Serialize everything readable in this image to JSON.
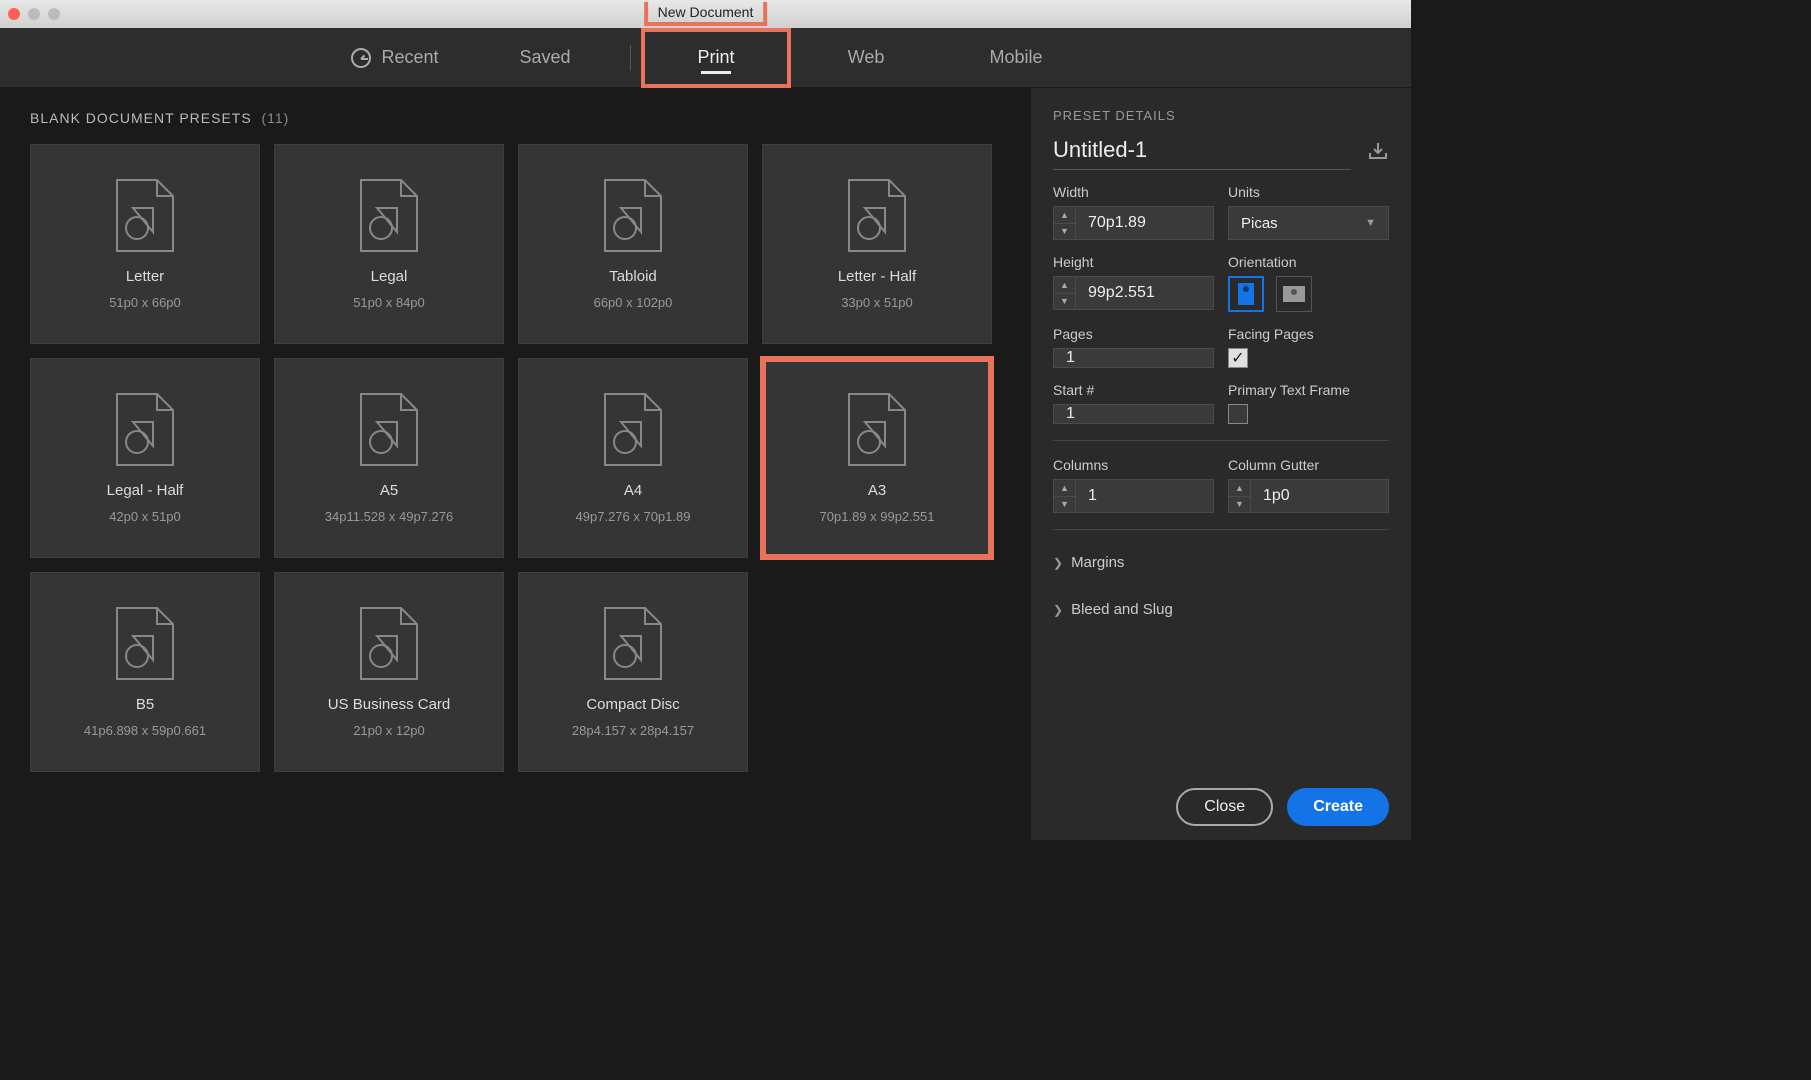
{
  "window": {
    "title": "New Document"
  },
  "tabs": {
    "recent": "Recent",
    "saved": "Saved",
    "print": "Print",
    "web": "Web",
    "mobile": "Mobile",
    "active": "print"
  },
  "presets": {
    "heading": "BLANK DOCUMENT PRESETS",
    "count": "(11)",
    "items": [
      {
        "name": "Letter",
        "dims": "51p0 x 66p0"
      },
      {
        "name": "Legal",
        "dims": "51p0 x 84p0"
      },
      {
        "name": "Tabloid",
        "dims": "66p0 x 102p0"
      },
      {
        "name": "Letter - Half",
        "dims": "33p0 x 51p0"
      },
      {
        "name": "Legal - Half",
        "dims": "42p0 x 51p0"
      },
      {
        "name": "A5",
        "dims": "34p11.528 x 49p7.276"
      },
      {
        "name": "A4",
        "dims": "49p7.276 x 70p1.89"
      },
      {
        "name": "A3",
        "dims": "70p1.89 x 99p2.551",
        "selected": true,
        "annotated": true
      },
      {
        "name": "B5",
        "dims": "41p6.898 x 59p0.661"
      },
      {
        "name": "US Business Card",
        "dims": "21p0 x 12p0"
      },
      {
        "name": "Compact Disc",
        "dims": "28p4.157 x 28p4.157"
      }
    ]
  },
  "details": {
    "heading": "PRESET DETAILS",
    "docName": "Untitled-1",
    "widthLabel": "Width",
    "width": "70p1.89",
    "unitsLabel": "Units",
    "units": "Picas",
    "heightLabel": "Height",
    "height": "99p2.551",
    "orientationLabel": "Orientation",
    "pagesLabel": "Pages",
    "pages": "1",
    "facingPagesLabel": "Facing Pages",
    "facingPages": true,
    "startLabel": "Start #",
    "start": "1",
    "primaryTextFrameLabel": "Primary Text Frame",
    "primaryTextFrame": false,
    "columnsLabel": "Columns",
    "columns": "1",
    "columnGutterLabel": "Column Gutter",
    "columnGutter": "1p0",
    "marginsLabel": "Margins",
    "bleedLabel": "Bleed and Slug"
  },
  "footer": {
    "close": "Close",
    "create": "Create"
  }
}
